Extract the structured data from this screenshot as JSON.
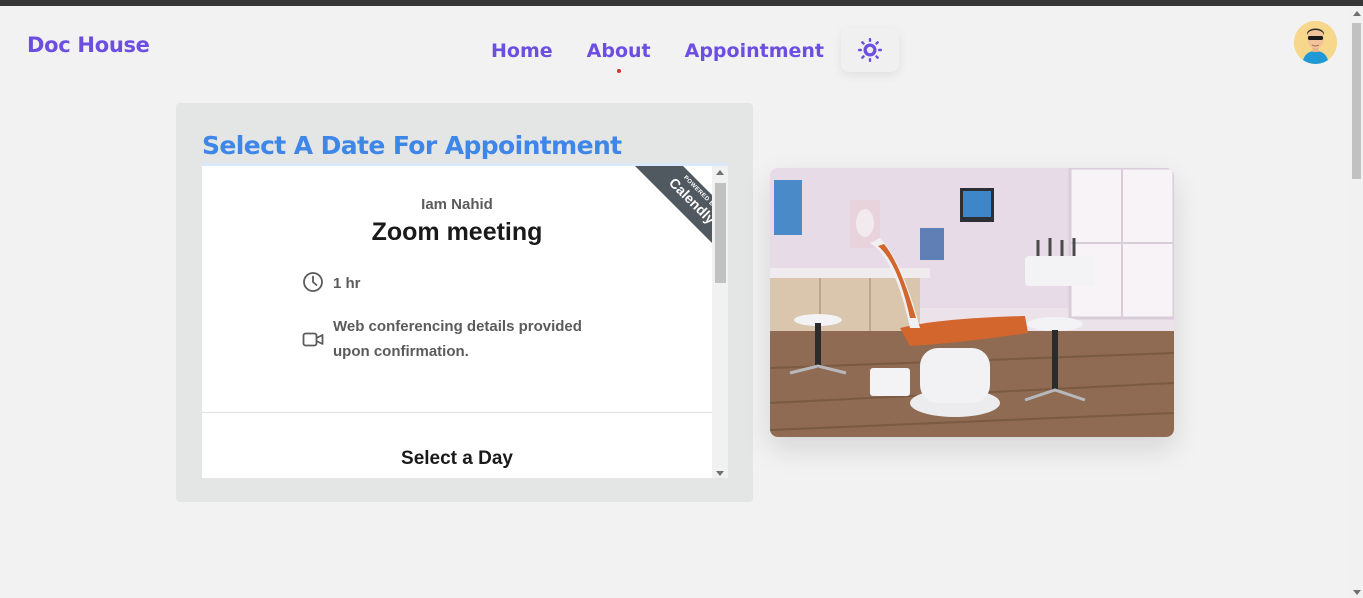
{
  "header": {
    "brand": "Doc House",
    "nav": [
      {
        "label": "Home",
        "active": false
      },
      {
        "label": "About",
        "active": true
      },
      {
        "label": "Appointment",
        "active": false
      }
    ],
    "theme_toggle_icon": "sun-icon",
    "avatar_icon": "user-avatar"
  },
  "colors": {
    "brand": "#6c4ee0",
    "title": "#3e86e8",
    "active_dot": "#d9302b",
    "ribbon": "#505860"
  },
  "appointment": {
    "title": "Select A Date For Appointment",
    "embed": {
      "ribbon_small": "POWERED BY",
      "ribbon_big": "Calendly",
      "host": "Iam Nahid",
      "event_name": "Zoom meeting",
      "duration": "1 hr",
      "duration_icon": "clock-icon",
      "location": "Web conferencing details provided upon confirmation.",
      "location_line1": "Web conferencing details provided",
      "location_line2": "upon confirmation.",
      "location_icon": "video-camera-icon",
      "select_day": "Select a Day"
    }
  },
  "photo": {
    "subject": "dental-clinic-photo"
  }
}
